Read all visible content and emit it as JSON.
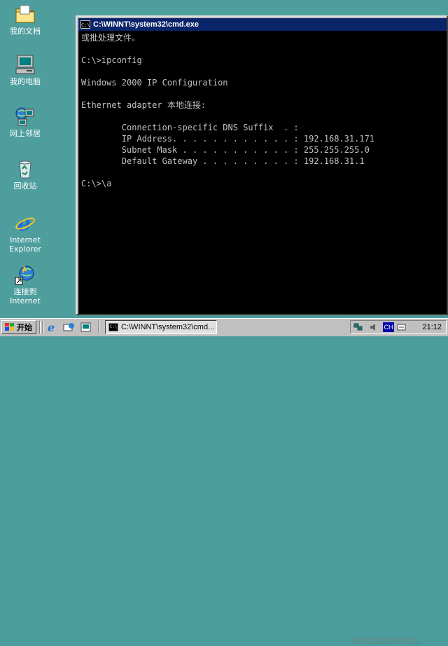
{
  "desktop": {
    "icons": [
      {
        "label": "我的文档",
        "icon": "folder-icon"
      },
      {
        "label": "我的电脑",
        "icon": "computer-icon"
      },
      {
        "label": "网上邻居",
        "icon": "network-icon"
      },
      {
        "label": "回收站",
        "icon": "recycle-bin-icon"
      },
      {
        "label": "Internet\nExplorer",
        "icon": "internet-explorer-icon"
      },
      {
        "label": "连接到\nInternet",
        "icon": "connect-internet-icon"
      }
    ]
  },
  "window": {
    "title": "C:\\WINNT\\system32\\cmd.exe",
    "console_lines": [
      "或批处理文件。",
      "",
      "C:\\>ipconfig",
      "",
      "Windows 2000 IP Configuration",
      "",
      "Ethernet adapter 本地连接:",
      "",
      "        Connection-specific DNS Suffix  . :",
      "        IP Address. . . . . . . . . . . . : 192.168.31.171",
      "        Subnet Mask . . . . . . . . . . . : 255.255.255.0",
      "        Default Gateway . . . . . . . . . : 192.168.31.1",
      "",
      "C:\\>\\a"
    ]
  },
  "taskbar": {
    "start_label": "开始",
    "task_button_label": "C:\\WINNT\\system32\\cmd...",
    "tray_lang": "CH",
    "clock": "21:12",
    "watermark": "@稀土掘金技术社区"
  },
  "colors": {
    "desktop": "#4f9e9e",
    "titlebar": "#0a246a",
    "console_bg": "#000000",
    "console_fg": "#c0c0c0"
  }
}
